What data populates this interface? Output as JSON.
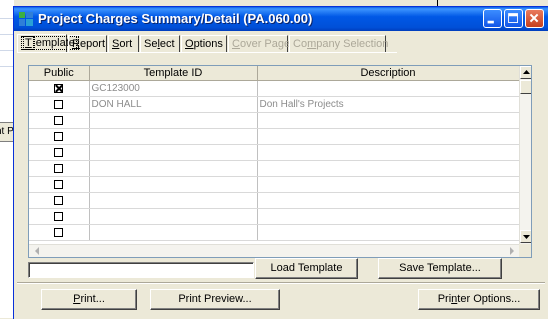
{
  "window": {
    "title": "Project Charges Summary/Detail (PA.060.00)",
    "title_bar_color": "#0055e5"
  },
  "background_app": {
    "button_text": "nt P"
  },
  "tabs": [
    {
      "label_u": "T",
      "label_rest": "emplate",
      "active": true,
      "enabled": true
    },
    {
      "label_u": "R",
      "label_rest": "eport",
      "active": false,
      "enabled": true
    },
    {
      "label_u": "S",
      "label_rest": "ort",
      "active": false,
      "enabled": true
    },
    {
      "label_pre": "Se",
      "label_u": "l",
      "label_rest": "ect",
      "active": false,
      "enabled": true
    },
    {
      "label_u": "O",
      "label_rest": "ptions",
      "active": false,
      "enabled": true
    },
    {
      "label_u": "C",
      "label_rest": "over Page",
      "active": false,
      "enabled": false
    },
    {
      "label_pre": "Co",
      "label_u": "m",
      "label_rest": "pany Selection",
      "active": false,
      "enabled": false
    }
  ],
  "grid": {
    "columns": [
      "Public",
      "Template ID",
      "Description"
    ],
    "rows": [
      {
        "public": true,
        "template_id": "GC123000",
        "description": ""
      },
      {
        "public": false,
        "template_id": "DON HALL",
        "description": "Don Hall's Projects"
      },
      {
        "public": false,
        "template_id": "",
        "description": ""
      },
      {
        "public": false,
        "template_id": "",
        "description": ""
      },
      {
        "public": false,
        "template_id": "",
        "description": ""
      },
      {
        "public": false,
        "template_id": "",
        "description": ""
      },
      {
        "public": false,
        "template_id": "",
        "description": ""
      },
      {
        "public": false,
        "template_id": "",
        "description": ""
      },
      {
        "public": false,
        "template_id": "",
        "description": ""
      },
      {
        "public": false,
        "template_id": "",
        "description": ""
      }
    ]
  },
  "template_name_input": {
    "value": ""
  },
  "buttons": {
    "load_template": "Load Template",
    "save_template": "Save Template...",
    "print_u": "P",
    "print_rest": "rint...",
    "print_preview": "Print Preview...",
    "printer_options_pre": "Pri",
    "printer_options_u": "n",
    "printer_options_rest": "ter Options..."
  }
}
